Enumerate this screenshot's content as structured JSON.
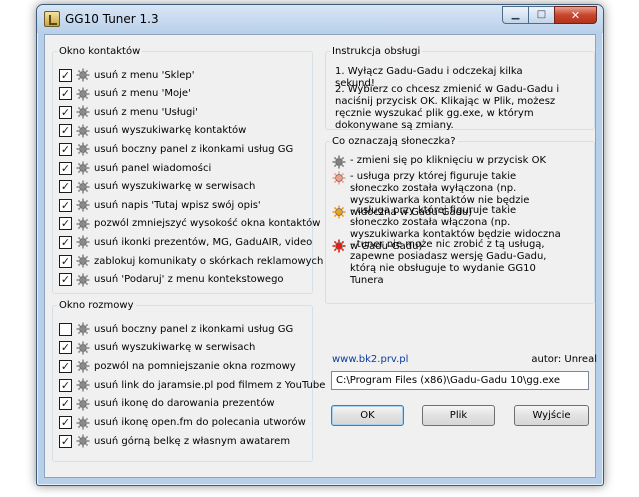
{
  "window": {
    "title": "GG10 Tuner 1.3"
  },
  "contacts": {
    "legend": "Okno kontaktów",
    "items": [
      {
        "label": "usuń z menu 'Sklep'",
        "checked": true
      },
      {
        "label": "usuń z menu 'Moje'",
        "checked": true
      },
      {
        "label": "usuń z menu 'Usługi'",
        "checked": true
      },
      {
        "label": "usuń wyszukiwarkę kontaktów",
        "checked": true
      },
      {
        "label": "usuń boczny panel z ikonkami usług GG",
        "checked": true
      },
      {
        "label": "usuń panel wiadomości",
        "checked": true
      },
      {
        "label": "usuń wyszukiwarkę w serwisach",
        "checked": true
      },
      {
        "label": "usuń napis 'Tutaj wpisz swój opis'",
        "checked": true
      },
      {
        "label": "pozwól zmniejszyć wysokość okna kontaktów",
        "checked": true
      },
      {
        "label": "usuń ikonki prezentów, MG, GaduAIR, video",
        "checked": true
      },
      {
        "label": "zablokuj komunikaty o skórkach reklamowych",
        "checked": true
      },
      {
        "label": "usuń 'Podaruj' z menu kontekstowego",
        "checked": true
      }
    ]
  },
  "conversation": {
    "legend": "Okno rozmowy",
    "items": [
      {
        "label": "usuń boczny panel z ikonkami usług GG",
        "checked": false
      },
      {
        "label": "usuń wyszukiwarkę w serwisach",
        "checked": true
      },
      {
        "label": "pozwól na pomniejszanie okna rozmowy",
        "checked": true
      },
      {
        "label": "usuń link do jaramsie.pl pod filmem z YouTube",
        "checked": true
      },
      {
        "label": "usuń ikonę do darowania prezentów",
        "checked": true
      },
      {
        "label": "usuń ikonę open.fm do polecania utworów",
        "checked": true
      },
      {
        "label": "usuń górną belkę z własnym awatarem",
        "checked": true
      }
    ]
  },
  "instructions": {
    "legend": "Instrukcja obsługi",
    "step1": "1. Wyłącz Gadu-Gadu i odczekaj kilka sekund!",
    "step2": "2. Wybierz co chcesz zmienić w Gadu-Gadu i naciśnij przycisk OK. Klikając w Plik, możesz ręcznie wyszukać plik gg.exe, w którym dokonywane są zmiany."
  },
  "suns": {
    "legend": "Co oznaczają słoneczka?",
    "items": [
      {
        "icon": "gray-sun-icon",
        "color": "#808080",
        "text": "- zmieni się po kliknięciu w przycisk OK"
      },
      {
        "icon": "light-sun-icon",
        "color": "#f3a08a",
        "text": "- usługa przy której figuruje takie słoneczko została wyłączona (np. wyszukiwarka kontaktów nie będzie widoczna w Gadu-Gadu)"
      },
      {
        "icon": "orange-sun-icon",
        "color": "#f0a020",
        "text": "- usługa przy której figuruje takie słoneczko została włączona (np. wyszukiwarka kontaktów będzie widoczna w Gadu-Gadu)"
      },
      {
        "icon": "red-sun-icon",
        "color": "#e02010",
        "text": "- tuner nie może nic zrobić z tą usługą, zapewne posiadasz wersję Gadu-Gadu, którą nie obsługuje to wydanie GG10 Tunera"
      }
    ]
  },
  "footer": {
    "link": "www.bk2.prv.pl",
    "author": "autor: Unreal",
    "path": "C:\\Program Files (x86)\\Gadu-Gadu 10\\gg.exe"
  },
  "buttons": {
    "ok": "OK",
    "file": "Plik",
    "exit": "Wyjście"
  },
  "colors": {
    "sun_default": "#8a8a8a",
    "link": "#0a3ca0"
  }
}
